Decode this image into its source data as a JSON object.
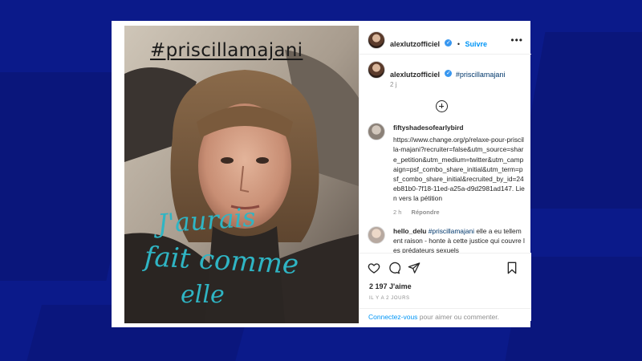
{
  "photo": {
    "hashtag": "#priscillamajani",
    "handwriting": [
      "J'aurais",
      "fait comme",
      "elle"
    ]
  },
  "post": {
    "username": "alexlutzofficiel",
    "follow_label": "Suivre",
    "separator": "•",
    "caption_hashtag": "#priscillamajani",
    "caption_time": "2 j",
    "more_label": "•••"
  },
  "comments": [
    {
      "username": "fiftyshadesofearlybird",
      "text": "https://www.change.org/p/relaxe-pour-priscilla-majani?recruiter=false&utm_source=share_petition&utm_medium=twitter&utm_campaign=psf_combo_share_initial&utm_term=psf_combo_share_initial&recruited_by_id=24eb81b0-7f18-11ed-a25a-d9d2981ad147. Lien vers la pétition",
      "time": "2 h",
      "reply_label": "Répondre"
    },
    {
      "username": "hello_delu",
      "hashtag": "#priscillamajani",
      "text": " elle a eu tellement raison - honte à cette justice qui couvre les prédateurs sexuels"
    }
  ],
  "actions": {
    "likes": "2 197 J'aime",
    "posted_ago": "IL Y A 2 JOURS"
  },
  "login": {
    "link_text": "Connectez-vous",
    "rest_text": " pour aimer ou commenter."
  },
  "colors": {
    "background": "#0b1a8a",
    "link_blue": "#0095f6",
    "verified_blue": "#3897f0",
    "handwriting": "#2fb5c4"
  },
  "icons": [
    "more-icon",
    "verified-icon",
    "add-comment-icon",
    "heart-icon",
    "comment-icon",
    "share-icon",
    "bookmark-icon"
  ]
}
